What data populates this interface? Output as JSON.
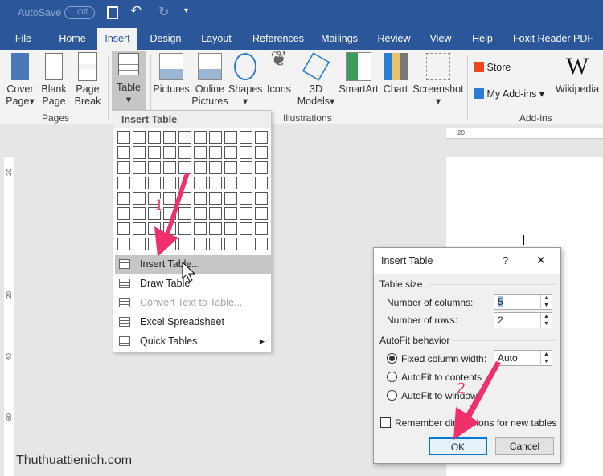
{
  "titlebar": {
    "autosave": "AutoSave",
    "autosave_state": "Off"
  },
  "tabs": [
    "File",
    "Home",
    "Insert",
    "Design",
    "Layout",
    "References",
    "Mailings",
    "Review",
    "View",
    "Help",
    "Foxit Reader PDF"
  ],
  "active_tab": "Insert",
  "ribbon": {
    "pages": {
      "group": "Pages",
      "cover": [
        "Cover",
        "Page"
      ],
      "blank": [
        "Blank",
        "Page"
      ],
      "break": [
        "Page",
        "Break"
      ]
    },
    "table": "Table",
    "illustrations": {
      "group": "Illustrations",
      "pictures": "Pictures",
      "online": [
        "Online",
        "Pictures"
      ],
      "shapes": "Shapes",
      "icons": "Icons",
      "models": [
        "3D",
        "Models"
      ],
      "smartart": "SmartArt",
      "chart": "Chart",
      "screenshot": "Screenshot"
    },
    "addins": {
      "group": "Add-ins",
      "store": "Store",
      "my": "My Add-ins",
      "wiki": "Wikipedia",
      "wiki_logo": "W"
    }
  },
  "ruler": {
    "h": [
      "20"
    ],
    "v": [
      "20",
      "20",
      "40",
      "60"
    ]
  },
  "menu": {
    "header": "Insert Table",
    "grid_cols": 10,
    "grid_rows": 8,
    "items": [
      {
        "label": "Insert Table...",
        "state": "highlighted"
      },
      {
        "label": "Draw Table"
      },
      {
        "label": "Convert Text to Table...",
        "state": "disabled"
      },
      {
        "label": "Excel Spreadsheet"
      },
      {
        "label": "Quick Tables",
        "submenu": true
      }
    ]
  },
  "dialog": {
    "title": "Insert Table",
    "help": "?",
    "close": "✕",
    "table_size": "Table size",
    "columns_label": "Number of columns:",
    "columns": "5",
    "rows_label": "Number of rows:",
    "rows": "2",
    "autofit": "AutoFit behavior",
    "fixed": "Fixed column width:",
    "fixed_value": "Auto",
    "contents": "AutoFit to contents",
    "window": "AutoFit to window",
    "remember": "Remember dimensions for new tables",
    "ok": "OK",
    "cancel": "Cancel",
    "selected_option": "fixed"
  },
  "annotations": {
    "step1": "1",
    "step2": "2",
    "color": "#f0306a"
  },
  "watermark": "Thuthuattienich.com"
}
